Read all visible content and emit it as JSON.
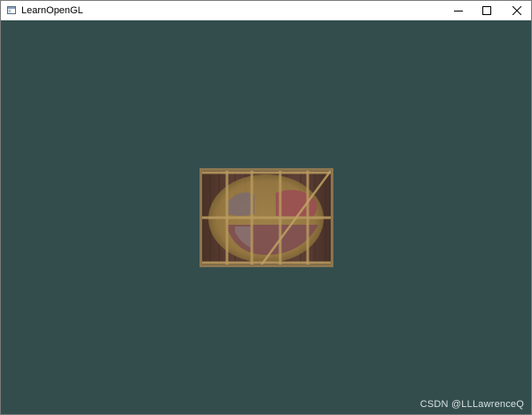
{
  "window": {
    "title": "LearnOpenGL",
    "app_icon": "window-app-icon",
    "controls": {
      "minimize_icon": "minimize-icon",
      "maximize_icon": "maximize-icon",
      "close_icon": "close-icon"
    }
  },
  "scene": {
    "clear_color": "#334d4d",
    "object": "textured-quad-crate-awesomeface"
  },
  "watermark": {
    "text": "CSDN @LLLawrenceQ"
  }
}
